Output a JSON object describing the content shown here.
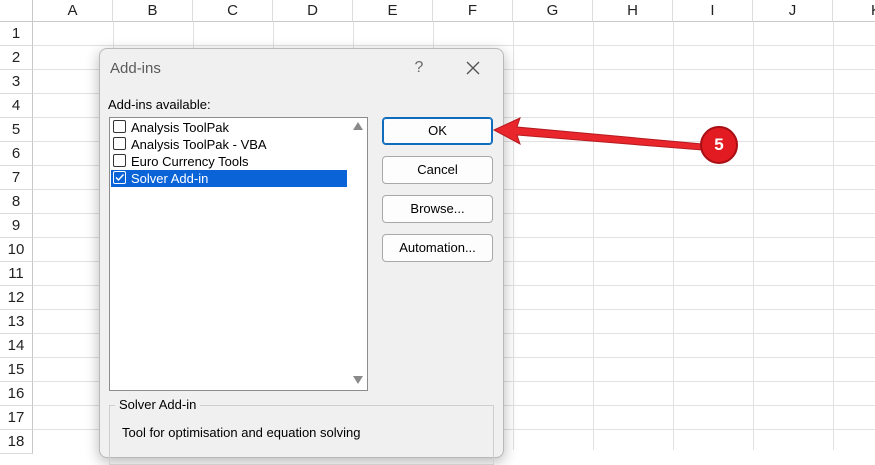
{
  "spreadsheet": {
    "columns": [
      "A",
      "B",
      "C",
      "D",
      "E",
      "F",
      "G",
      "H",
      "I",
      "J",
      "K"
    ],
    "rows": [
      "1",
      "2",
      "3",
      "4",
      "5",
      "6",
      "7",
      "8",
      "9",
      "10",
      "11",
      "12",
      "13",
      "14",
      "15",
      "16",
      "17",
      "18"
    ]
  },
  "dialog": {
    "title": "Add-ins",
    "help_label": "?",
    "available_label": "Add-ins available:",
    "addins": [
      {
        "label": "Analysis ToolPak",
        "checked": false,
        "selected": false
      },
      {
        "label": "Analysis ToolPak - VBA",
        "checked": false,
        "selected": false
      },
      {
        "label": "Euro Currency Tools",
        "checked": false,
        "selected": false
      },
      {
        "label": "Solver Add-in",
        "checked": true,
        "selected": true
      }
    ],
    "buttons": {
      "ok": "OK",
      "cancel": "Cancel",
      "browse": "Browse...",
      "automation": "Automation..."
    },
    "description": {
      "title": "Solver Add-in",
      "text": "Tool for optimisation and equation solving"
    }
  },
  "annotation": {
    "step_number": "5",
    "color": "#e21b22"
  }
}
